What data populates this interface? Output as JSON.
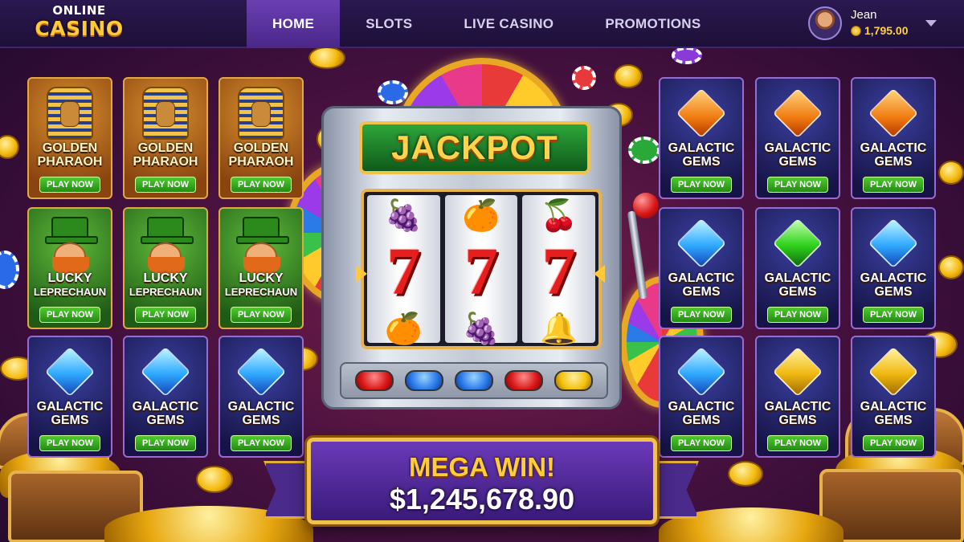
{
  "logo": {
    "top": "ONLINE",
    "main": "CASINO"
  },
  "nav": [
    {
      "label": "HOME",
      "active": true
    },
    {
      "label": "SLOTS",
      "active": false
    },
    {
      "label": "LIVE CASINO",
      "active": false
    },
    {
      "label": "PROMOTIONS",
      "active": false
    }
  ],
  "user": {
    "name": "Jean",
    "balance": "1,795.00"
  },
  "games_left": [
    {
      "name": "GOLDEN PHARAOH",
      "line1": "GOLDEN",
      "line2": "PHARAOH",
      "theme": "pharaoh",
      "cta": "PLAY NOW"
    },
    {
      "name": "GOLDEN PHARAOH",
      "line1": "GOLDEN",
      "line2": "PHARAOH",
      "theme": "pharaoh",
      "cta": "PLAY NOW"
    },
    {
      "name": "GOLDEN PHARAOH",
      "line1": "GOLDEN",
      "line2": "PHARAOH",
      "theme": "pharaoh",
      "cta": "PLAY NOW"
    },
    {
      "name": "LUCKY LEPRECHAUN",
      "line1": "LUCKY",
      "line2": "LEPRECHAUN",
      "theme": "leprechaun",
      "cta": "PLAY NOW"
    },
    {
      "name": "LUCKY LEPRECHAUN",
      "line1": "LUCKY",
      "line2": "LEPRECHAUN",
      "theme": "leprechaun",
      "cta": "PLAY NOW"
    },
    {
      "name": "LUCKY LEPRECHAUN",
      "line1": "LUCKY",
      "line2": "LEPRECHAUN",
      "theme": "leprechaun",
      "cta": "PLAY NOW"
    },
    {
      "name": "GALACTIC GEMS",
      "line1": "GALACTIC",
      "line2": "GEMS",
      "theme": "gems",
      "gem_color": "blue",
      "cta": "PLAY NOW"
    },
    {
      "name": "GALACTIC GEMS",
      "line1": "GALACTIC",
      "line2": "GEMS",
      "theme": "gems",
      "gem_color": "blue",
      "cta": "PLAY NOW"
    },
    {
      "name": "GALACTIC GEMS",
      "line1": "GALACTIC",
      "line2": "GEMS",
      "theme": "gems",
      "gem_color": "blue",
      "cta": "PLAY NOW"
    }
  ],
  "games_right": [
    {
      "line1": "GALACTIC",
      "line2": "GEMS",
      "gem_color": "orange",
      "cta": "PLAY NOW"
    },
    {
      "line1": "GALACTIC",
      "line2": "GEMS",
      "gem_color": "orange",
      "cta": "PLAY NOW"
    },
    {
      "line1": "GALACTIC",
      "line2": "GEMS",
      "gem_color": "orange",
      "cta": "PLAY NOW"
    },
    {
      "line1": "GALACTIC",
      "line2": "GEMS",
      "gem_color": "blue",
      "cta": "PLAY NOW"
    },
    {
      "line1": "GALACTIC",
      "line2": "GEMS",
      "gem_color": "green",
      "cta": "PLAY NOW"
    },
    {
      "line1": "GALACTIC",
      "line2": "GEMS",
      "gem_color": "blue",
      "cta": "PLAY NOW"
    },
    {
      "line1": "GALACTIC",
      "line2": "GEMS",
      "gem_color": "blue",
      "cta": "PLAY NOW"
    },
    {
      "line1": "GALACTIC",
      "line2": "GEMS",
      "gem_color": "gold",
      "cta": "PLAY NOW"
    },
    {
      "line1": "GALACTIC",
      "line2": "GEMS",
      "gem_color": "gold",
      "cta": "PLAY NOW"
    }
  ],
  "slot_machine": {
    "sign": "JACKPOT",
    "reels": [
      {
        "top": "🍇",
        "middle": "7",
        "bottom": "🍊"
      },
      {
        "top": "🍊",
        "middle": "7",
        "bottom": "🍇"
      },
      {
        "top": "🍒",
        "middle": "7",
        "bottom": "🔔"
      }
    ],
    "buttons": [
      "red",
      "blue",
      "blue",
      "red",
      "yellow"
    ]
  },
  "mega_win": {
    "title": "MEGA WIN!",
    "amount": "$1,245,678.90"
  },
  "colors": {
    "accent_gold": "#ffc93a",
    "nav_active": "#6a3fb3",
    "play_button": "#34a81e",
    "background": "#4a1240"
  }
}
